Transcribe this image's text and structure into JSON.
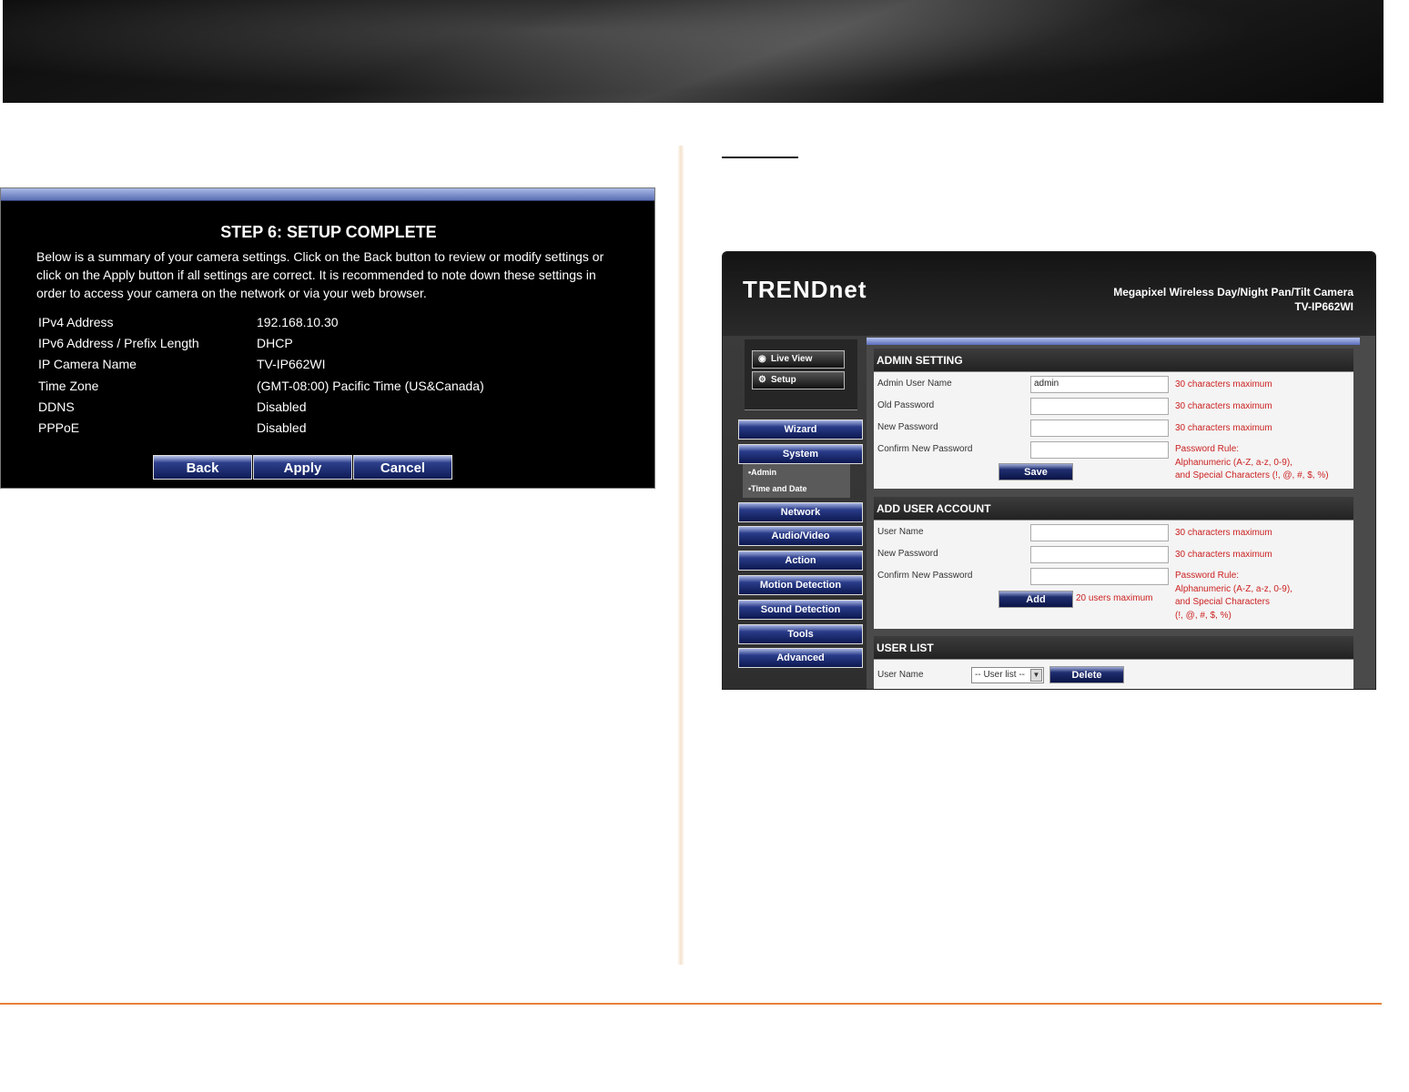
{
  "setup": {
    "title": "STEP 6: SETUP COMPLETE",
    "description": "Below is a summary of your camera settings. Click on the Back button to review or modify settings or click on the Apply button if all settings are correct. It is recommended to note down these settings in order to access your camera on the network or via your web browser.",
    "rows": [
      {
        "label": "IPv4 Address",
        "value": "192.168.10.30"
      },
      {
        "label": "IPv6 Address / Prefix Length",
        "value": "DHCP"
      },
      {
        "label": "IP Camera Name",
        "value": "TV-IP662WI"
      },
      {
        "label": "Time Zone",
        "value": "(GMT-08:00) Pacific Time (US&Canada)"
      },
      {
        "label": "DDNS",
        "value": "Disabled"
      },
      {
        "label": "PPPoE",
        "value": "Disabled"
      }
    ],
    "buttons": {
      "back": "Back",
      "apply": "Apply",
      "cancel": "Cancel"
    }
  },
  "camera": {
    "logo": "TRENDnet",
    "product_line1": "Megapixel Wireless Day/Night Pan/Tilt Camera",
    "product_line2": "TV-IP662WI",
    "sidebar": {
      "live_view": "Live View",
      "setup": "Setup",
      "items": [
        "Wizard",
        "System",
        "Network",
        "Audio/Video",
        "Action",
        "Motion Detection",
        "Sound Detection",
        "Tools",
        "Advanced"
      ],
      "system_sub": [
        "•Admin",
        "•Time and Date"
      ]
    },
    "admin": {
      "title": "ADMIN SETTING",
      "labels": [
        "Admin User Name",
        "Old Password",
        "New Password",
        "Confirm New Password"
      ],
      "admin_value": "admin",
      "hints": [
        "30 characters maximum",
        "30 characters maximum",
        "30 characters maximum"
      ],
      "rule": [
        "Password Rule:",
        "Alphanumeric (A-Z, a-z, 0-9),",
        "and Special Characters   (!, @, #, $, %)"
      ],
      "save": "Save"
    },
    "add_user": {
      "title": "ADD USER ACCOUNT",
      "labels": [
        "User Name",
        "New Password",
        "Confirm New Password"
      ],
      "hints": [
        "30 characters maximum",
        "30 characters maximum"
      ],
      "rule": [
        "Password Rule:",
        "Alphanumeric (A-Z, a-z, 0-9),",
        "and Special Characters",
        "(!, @, #, $, %)"
      ],
      "add": "Add",
      "max_users": "20 users maximum"
    },
    "user_list": {
      "title": "USER LIST",
      "label": "User Name",
      "select_value": "-- User list --",
      "delete": "Delete"
    }
  }
}
